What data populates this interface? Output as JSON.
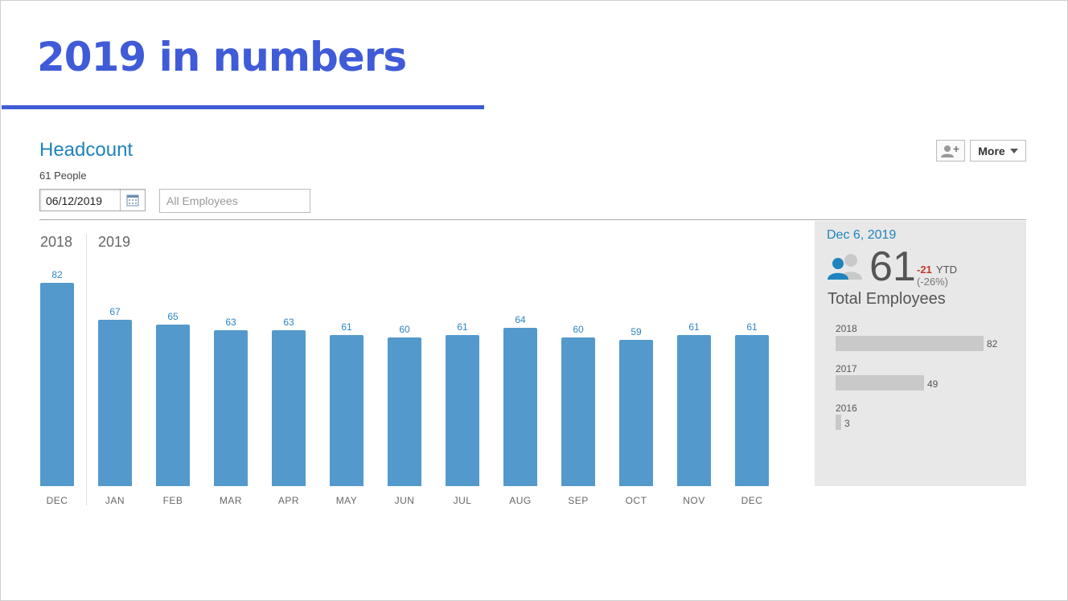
{
  "slide": {
    "title": "2019 in numbers"
  },
  "widget": {
    "title": "Headcount",
    "people_count": "61 People",
    "date_value": "06/12/2019",
    "filter_placeholder": "All Employees",
    "more_label": "More",
    "icons": {
      "calendar": "calendar-icon",
      "add_person": "add-person-icon",
      "people": "people-icon",
      "caret": "caret-down-icon"
    }
  },
  "chart_data": {
    "type": "bar",
    "year_labels": [
      "2018",
      "2019"
    ],
    "categories": [
      "DEC",
      "JAN",
      "FEB",
      "MAR",
      "APR",
      "MAY",
      "JUN",
      "JUL",
      "AUG",
      "SEP",
      "OCT",
      "NOV",
      "DEC"
    ],
    "values": [
      82,
      67,
      65,
      63,
      63,
      61,
      60,
      61,
      64,
      60,
      59,
      61,
      61
    ],
    "ylim": [
      0,
      82
    ],
    "grid": false,
    "colors": {
      "bar": "#5399cb",
      "value_label": "#2c86c2"
    }
  },
  "summary": {
    "date": "Dec 6, 2019",
    "total": "61",
    "ytd_change": "-21",
    "ytd_label": "YTD",
    "ytd_percent": "(-26%)",
    "total_label": "Total Employees",
    "history": [
      {
        "year": "2018",
        "value": 82
      },
      {
        "year": "2017",
        "value": 49
      },
      {
        "year": "2016",
        "value": 3
      }
    ]
  },
  "colors": {
    "title": "#3f5bd8",
    "accent": "#1f83bd",
    "negative": "#c0392b",
    "panel": "#e8e8e8",
    "history_bar": "#c9c9c9"
  }
}
